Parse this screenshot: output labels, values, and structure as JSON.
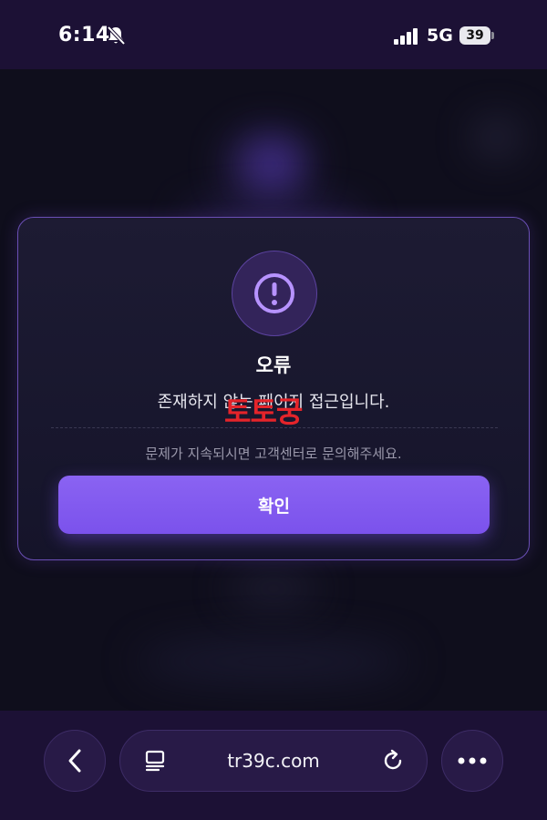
{
  "status_bar": {
    "time": "6:14",
    "network": "5G",
    "battery": "39",
    "icons": [
      "bell-slash-icon",
      "signal-icon"
    ]
  },
  "modal": {
    "icon": "exclamation-circle-icon",
    "title": "오류",
    "message": "존재하지 않는 페이지 접근입니다.",
    "watermark": "토토궁",
    "sub_message": "문제가 지속되시면 고객센터로 문의해주세요.",
    "confirm_label": "확인"
  },
  "browser_bar": {
    "url": "tr39c.com",
    "icons": [
      "back-arrow-icon",
      "reader-icon",
      "reload-icon",
      "more-icon"
    ]
  },
  "colors": {
    "accent": "#7b52ec",
    "watermark": "#e5242a",
    "bar_bg": "#1c1135"
  }
}
